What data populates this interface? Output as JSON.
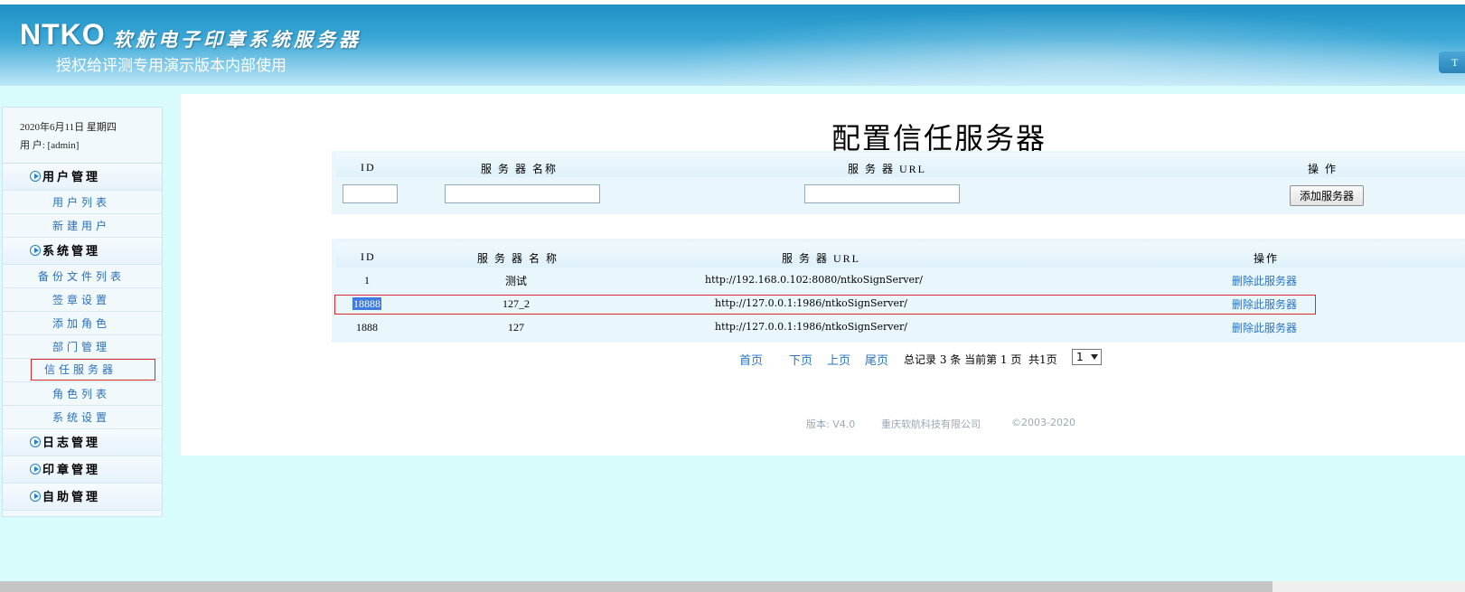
{
  "header": {
    "brand": "NTKO",
    "brand_sub": "软航电子印章系统服务器",
    "note": "授权给评测专用演示版本内部使用",
    "right_button": "T"
  },
  "sidebar": {
    "date": "2020年6月11日 星期四",
    "user": "用  户: [admin]",
    "sections": {
      "user_mgmt": "用户管理",
      "system_mgmt": "系统管理",
      "log_mgmt": "日志管理",
      "seal_mgmt": "印章管理",
      "self_mgmt": "自助管理"
    },
    "items": {
      "user_list": "用户列表",
      "new_user": "新建用户",
      "backup_list": "备份文件列表",
      "sign_settings": "签章设置",
      "add_role": "添加角色",
      "dept_mgmt": "部门管理",
      "trust_server": "信任服务器",
      "role_list": "角色列表",
      "system_settings": "系统设置"
    }
  },
  "main": {
    "title": "配置信任服务器",
    "form": {
      "col_id": "ID",
      "col_name": "服 务 器 名称",
      "col_url": "服 务 器 URL",
      "col_op": "操  作",
      "id_value": "",
      "name_value": "",
      "url_value": "",
      "add_button": "添加服务器"
    },
    "table": {
      "headers": [
        "ID",
        "服 务 器 名 称",
        "服 务 器 URL",
        "操作"
      ],
      "rows": [
        {
          "id": "1",
          "name": "测试",
          "url": "http://192.168.0.102:8080/ntkoSignServer/",
          "action": "删除此服务器"
        },
        {
          "id": "18888",
          "name": "127_2",
          "url": "http://127.0.0.1:1986/ntkoSignServer/",
          "action": "删除此服务器"
        },
        {
          "id": "1888",
          "name": "127",
          "url": "http://127.0.0.1:1986/ntkoSignServer/",
          "action": "删除此服务器"
        }
      ]
    },
    "pager": {
      "first": "首页",
      "next": "下页",
      "prev": "上页",
      "last": "尾页",
      "summary": "总记录 3 条 当前第 1 页  共1页",
      "page_value": "1"
    },
    "footer": {
      "version": "版本: V4.0",
      "company": "重庆软航科技有限公司",
      "copyright": "©2003-2020"
    }
  },
  "colors": {
    "background": "#d8fcfc",
    "link": "#2a73c2",
    "highlight_border": "#e02828",
    "header_blue": "#1a8fc4"
  }
}
